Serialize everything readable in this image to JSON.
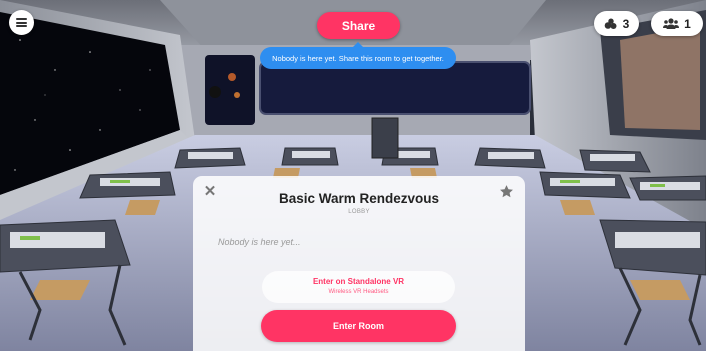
{
  "topbar": {
    "share_label": "Share",
    "share_tooltip": "Nobody is here yet. Share this room to get together.",
    "objects_count": "3",
    "people_count": "1"
  },
  "dialog": {
    "room_name": "Basic Warm Rendezvous",
    "subtitle": "LOBBY",
    "presence_text": "Nobody is here yet...",
    "vr_button_label": "Enter on Standalone VR",
    "vr_button_sub": "Wireless VR Headsets",
    "enter_button_label": "Enter Room"
  },
  "icons": {
    "menu": "hamburger-icon",
    "objects": "objects-icon",
    "people": "people-icon",
    "close": "close-icon",
    "favorite": "star-icon"
  },
  "colors": {
    "accent": "#ff3464",
    "tooltip": "#2e8ef0",
    "dialog_bg": "#ffffff"
  }
}
